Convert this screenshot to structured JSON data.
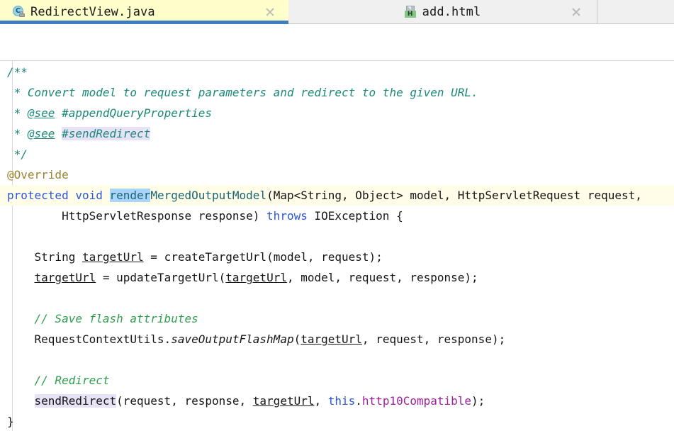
{
  "window": {
    "app": "intellij-idea-editor",
    "accent_color": "#3e7ec0",
    "active_tab_bg": "#ffffcc",
    "caret_line_bg": "#fffde8",
    "selection_bg": "#a9d4fb",
    "identifier_highlight_bg": "#e7e2f6"
  },
  "tabs": [
    {
      "label": "RedirectView.java",
      "icon": "java-class-icon",
      "lock_icon": "lock-icon",
      "close_icon": "close-icon",
      "active": true
    },
    {
      "label": "add.html",
      "icon": "html-file-icon",
      "badge": "H",
      "close_icon": "close-icon",
      "active": false
    }
  ],
  "editor": {
    "language": "java",
    "file": "RedirectView.java",
    "lines": [
      {
        "n": 1,
        "indent": 0,
        "tokens": [
          {
            "t": "/**",
            "c": "t-doc"
          }
        ]
      },
      {
        "n": 2,
        "indent": 0,
        "tokens": [
          {
            "t": " * Convert model to request parameters and redirect to the given URL.",
            "c": "t-doc"
          }
        ]
      },
      {
        "n": 3,
        "indent": 0,
        "tokens": [
          {
            "t": " * ",
            "c": "t-doc"
          },
          {
            "t": "@see",
            "c": "t-doctag"
          },
          {
            "t": " #appendQueryProperties",
            "c": "t-doc"
          }
        ]
      },
      {
        "n": 4,
        "indent": 0,
        "tokens": [
          {
            "t": " * ",
            "c": "t-doc"
          },
          {
            "t": "@see",
            "c": "t-doctag"
          },
          {
            "t": " ",
            "c": "t-doc"
          },
          {
            "t": "#sendRedirect",
            "c": "t-doc",
            "hl": "hl-ident"
          }
        ]
      },
      {
        "n": 5,
        "indent": 0,
        "tokens": [
          {
            "t": " */",
            "c": "t-doc"
          }
        ]
      },
      {
        "n": 6,
        "indent": 0,
        "tokens": [
          {
            "t": "@Override",
            "c": "t-anno"
          }
        ]
      },
      {
        "n": 7,
        "indent": 0,
        "caret": true,
        "tokens": [
          {
            "t": "protected",
            "c": "t-kw"
          },
          {
            "t": " ",
            "c": "t-plain"
          },
          {
            "t": "void",
            "c": "t-kw"
          },
          {
            "t": " ",
            "c": "t-plain"
          },
          {
            "t": "render",
            "c": "t-type",
            "hl": "hl-sel"
          },
          {
            "t": "MergedOutputModel",
            "c": "t-type"
          },
          {
            "t": "(Map<String, Object> model, HttpServletRequest request,",
            "c": "t-plain"
          }
        ]
      },
      {
        "n": 8,
        "indent": 0,
        "tokens": [
          {
            "t": "        HttpServletResponse response) ",
            "c": "t-plain"
          },
          {
            "t": "throws",
            "c": "t-kw"
          },
          {
            "t": " IOException {",
            "c": "t-plain"
          }
        ]
      },
      {
        "n": 9,
        "indent": 0,
        "tokens": []
      },
      {
        "n": 10,
        "indent": 0,
        "tokens": [
          {
            "t": "    String ",
            "c": "t-plain"
          },
          {
            "t": "targetUrl",
            "c": "t-localvar"
          },
          {
            "t": " = createTargetUrl(model, request);",
            "c": "t-plain"
          }
        ]
      },
      {
        "n": 11,
        "indent": 0,
        "tokens": [
          {
            "t": "    ",
            "c": "t-plain"
          },
          {
            "t": "targetUrl",
            "c": "t-localvar"
          },
          {
            "t": " = updateTargetUrl(",
            "c": "t-plain"
          },
          {
            "t": "targetUrl",
            "c": "t-localvar"
          },
          {
            "t": ", model, request, response);",
            "c": "t-plain"
          }
        ]
      },
      {
        "n": 12,
        "indent": 0,
        "tokens": []
      },
      {
        "n": 13,
        "indent": 0,
        "tokens": [
          {
            "t": "    // Save flash attributes",
            "c": "t-comment"
          }
        ]
      },
      {
        "n": 14,
        "indent": 0,
        "tokens": [
          {
            "t": "    RequestContextUtils.",
            "c": "t-plain"
          },
          {
            "t": "saveOutputFlashMap",
            "c": "t-static"
          },
          {
            "t": "(",
            "c": "t-plain"
          },
          {
            "t": "targetUrl",
            "c": "t-localvar"
          },
          {
            "t": ", request, response);",
            "c": "t-plain"
          }
        ]
      },
      {
        "n": 15,
        "indent": 0,
        "tokens": []
      },
      {
        "n": 16,
        "indent": 0,
        "tokens": [
          {
            "t": "    // Redirect",
            "c": "t-comment"
          }
        ]
      },
      {
        "n": 17,
        "indent": 0,
        "tokens": [
          {
            "t": "    ",
            "c": "t-plain"
          },
          {
            "t": "sendRedirect",
            "c": "t-plain",
            "hl": "hl-ident"
          },
          {
            "t": "(request, response, ",
            "c": "t-plain"
          },
          {
            "t": "targetUrl",
            "c": "t-localvar"
          },
          {
            "t": ", ",
            "c": "t-plain"
          },
          {
            "t": "this",
            "c": "t-kw"
          },
          {
            "t": ".",
            "c": "t-plain"
          },
          {
            "t": "http10Compatible",
            "c": "t-field"
          },
          {
            "t": ");",
            "c": "t-plain"
          }
        ]
      },
      {
        "n": 18,
        "indent": 0,
        "tokens": [
          {
            "t": "}",
            "c": "t-plain"
          }
        ]
      }
    ]
  }
}
